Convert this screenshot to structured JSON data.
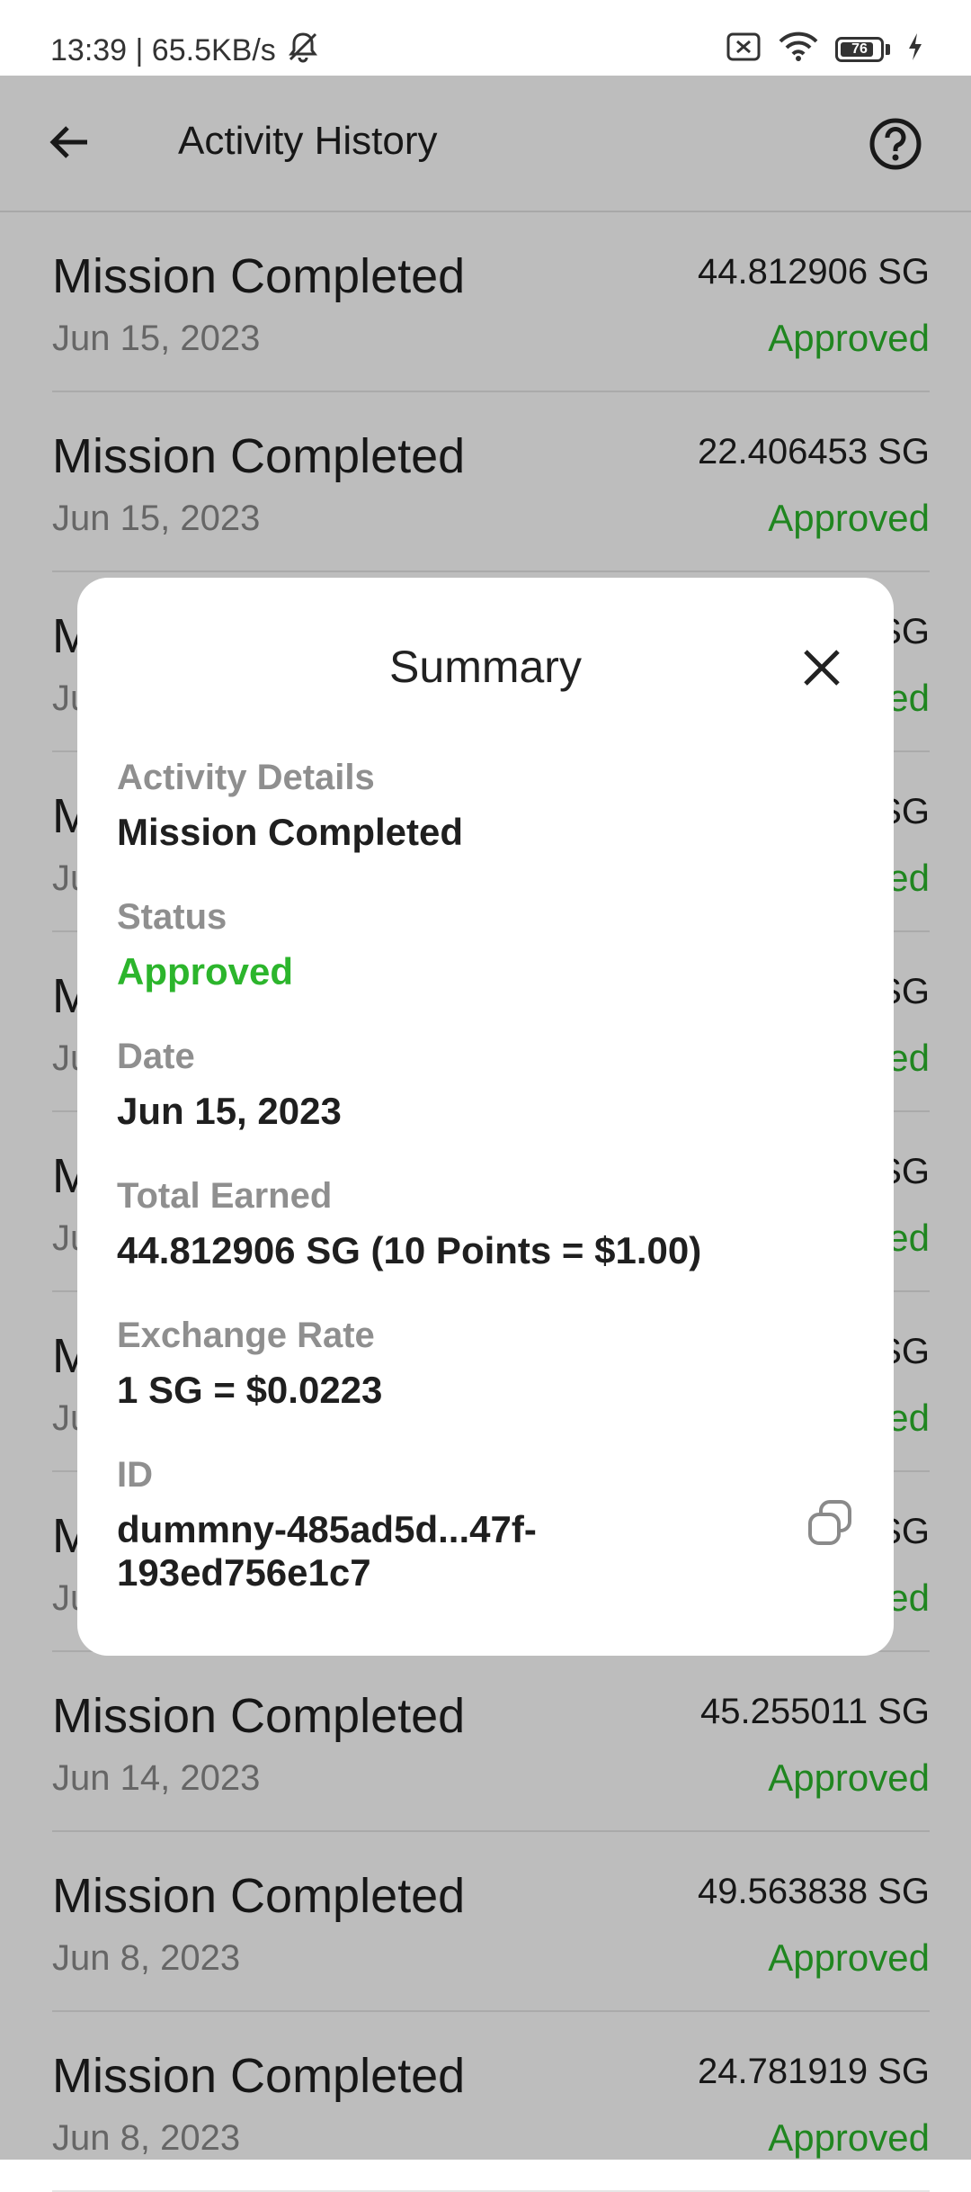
{
  "status_bar": {
    "time_speed": "13:39 | 65.5KB/s",
    "battery": "76",
    "icons": [
      "mute-icon",
      "sim-off-icon",
      "wifi-icon",
      "battery-icon",
      "charging-icon"
    ]
  },
  "app_bar": {
    "title": "Activity History",
    "back_icon": "arrow-left-icon",
    "help_icon": "help-circle-icon"
  },
  "colors": {
    "approved": "#2cb52c",
    "scrim": "rgba(0,0,0,0.26)"
  },
  "activities": [
    {
      "title": "Mission Completed",
      "date": "Jun 15, 2023",
      "amount": "44.812906 SG",
      "status": "Approved"
    },
    {
      "title": "Mission Completed",
      "date": "Jun 15, 2023",
      "amount": "22.406453 SG",
      "status": "Approved"
    },
    {
      "title": "M",
      "date": "Ju",
      "amount": "SG",
      "status": "ed"
    },
    {
      "title": "M",
      "date": "Ju",
      "amount": "SG",
      "status": "ed"
    },
    {
      "title": "M",
      "date": "Ju",
      "amount": "SG",
      "status": "ed"
    },
    {
      "title": "M",
      "date": "Ju",
      "amount": "SG",
      "status": "ed"
    },
    {
      "title": "M",
      "date": "Ju",
      "amount": "SG",
      "status": "ed"
    },
    {
      "title": "M",
      "date": "Ju",
      "amount": "SG",
      "status": "ed"
    },
    {
      "title": "Mission Completed",
      "date": "Jun 14, 2023",
      "amount": "45.255011 SG",
      "status": "Approved"
    },
    {
      "title": "Mission Completed",
      "date": "Jun 8, 2023",
      "amount": "49.563838 SG",
      "status": "Approved"
    },
    {
      "title": "Mission Completed",
      "date": "Jun 8, 2023",
      "amount": "24.781919 SG",
      "status": "Approved"
    }
  ],
  "summary": {
    "title": "Summary",
    "close_icon": "close-icon",
    "activity_details_label": "Activity Details",
    "activity_details_value": "Mission Completed",
    "status_label": "Status",
    "status_value": "Approved",
    "date_label": "Date",
    "date_value": "Jun 15, 2023",
    "total_earned_label": "Total Earned",
    "total_earned_value": "44.812906 SG (10 Points = $1.00)",
    "exchange_rate_label": "Exchange Rate",
    "exchange_rate_value": "1 SG = $0.0223",
    "id_label": "ID",
    "id_value": "dummny-485ad5d...47f-193ed756e1c7",
    "copy_icon": "copy-icon"
  }
}
